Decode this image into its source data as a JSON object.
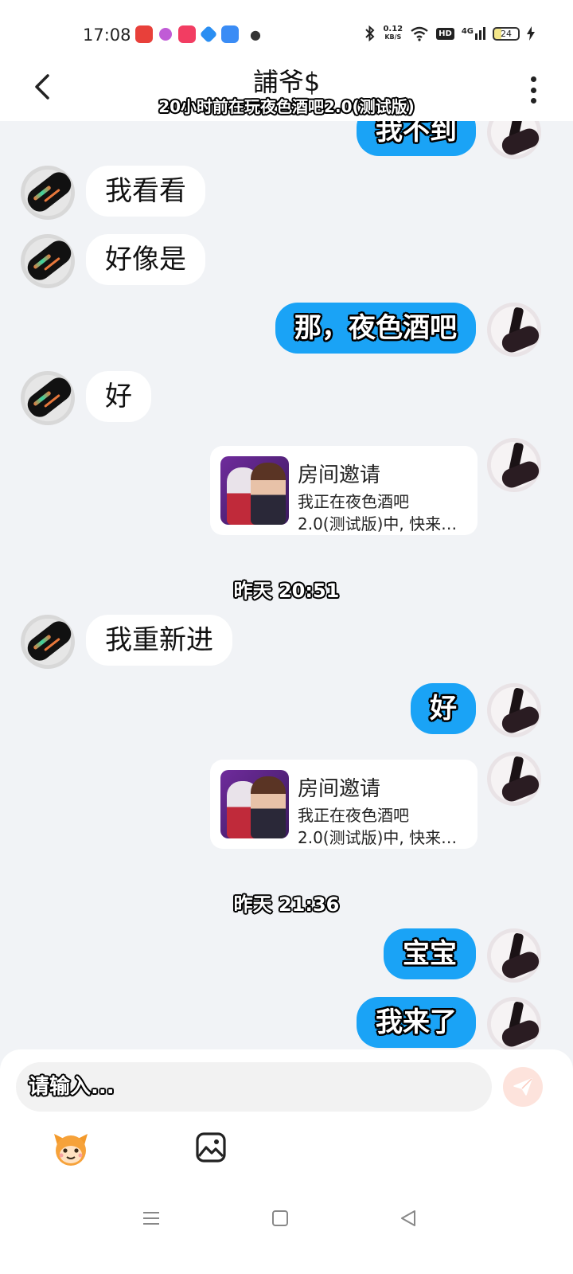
{
  "status_bar": {
    "time": "17:08",
    "net_speed_value": "0.12",
    "net_speed_unit": "KB/S",
    "hd": "HD",
    "network": "4G",
    "battery": "24"
  },
  "header": {
    "title": "誧爷$",
    "subtitle": "20小时前在玩夜色酒吧2.0(测试版)"
  },
  "messages": [
    {
      "side": "out",
      "text": "我不到"
    },
    {
      "side": "in",
      "text": "我看看"
    },
    {
      "side": "in",
      "text": "好像是"
    },
    {
      "side": "out",
      "text": "那，夜色酒吧"
    },
    {
      "side": "in",
      "text": "好"
    },
    {
      "side": "out",
      "type": "card",
      "title": "房间邀请",
      "desc_line1": "我正在夜色酒吧",
      "desc_line2": "2.0(测试版)中, 快来…"
    },
    {
      "type": "timestamp",
      "text": "昨天 20:51"
    },
    {
      "side": "in",
      "text": "我重新进"
    },
    {
      "side": "out",
      "text": "好"
    },
    {
      "side": "out",
      "type": "card",
      "title": "房间邀请",
      "desc_line1": "我正在夜色酒吧",
      "desc_line2": "2.0(测试版)中, 快来…"
    },
    {
      "type": "timestamp",
      "text": "昨天 21:36"
    },
    {
      "side": "out",
      "text": "宝宝"
    },
    {
      "side": "out",
      "text": "我来了"
    }
  ],
  "composer": {
    "placeholder": "请输入..."
  },
  "colors": {
    "outgoing_bubble": "#1aa3f6",
    "incoming_bubble": "#ffffff",
    "chat_background": "#f1f3f6",
    "send_button": "#fde3dc"
  }
}
